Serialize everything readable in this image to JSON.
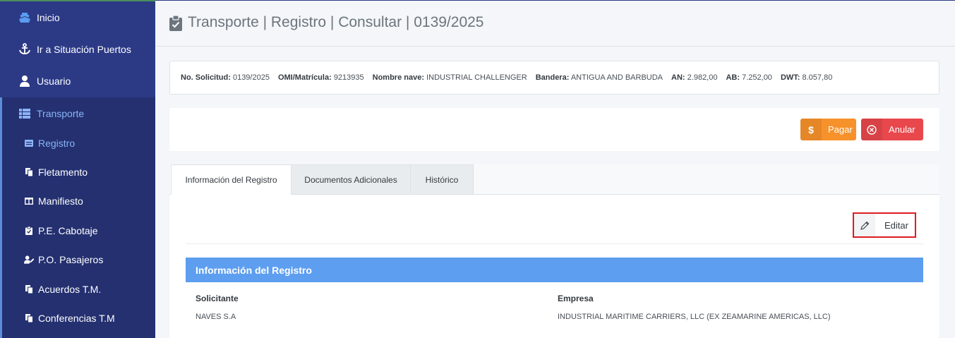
{
  "sidebar": {
    "items": [
      {
        "label": "Inicio",
        "icon": "ship-icon"
      },
      {
        "label": "Ir a Situación Puertos",
        "icon": "anchor-icon"
      },
      {
        "label": "Usuario",
        "icon": "user-icon"
      },
      {
        "label": "Transporte",
        "icon": "list-icon"
      }
    ],
    "subitems": [
      {
        "label": "Registro",
        "icon": "id-card-icon"
      },
      {
        "label": "Fletamento",
        "icon": "copy-icon"
      },
      {
        "label": "Manifiesto",
        "icon": "columns-icon"
      },
      {
        "label": "P.E. Cabotaje",
        "icon": "clipboard-check-icon"
      },
      {
        "label": "P.O. Pasajeros",
        "icon": "user-edit-icon"
      },
      {
        "label": "Acuerdos T.M.",
        "icon": "copy-icon"
      },
      {
        "label": "Conferencias T.M",
        "icon": "copy-icon"
      }
    ]
  },
  "header": {
    "title": "Transporte | Registro | Consultar | 0139/2025"
  },
  "infobar": [
    {
      "label": "No. Solicitud:",
      "value": "0139/2025"
    },
    {
      "label": "OMI/Matrícula:",
      "value": "9213935"
    },
    {
      "label": "Nombre nave:",
      "value": "INDUSTRIAL CHALLENGER"
    },
    {
      "label": "Bandera:",
      "value": "ANTIGUA AND BARBUDA"
    },
    {
      "label": "AN:",
      "value": "2.982,00"
    },
    {
      "label": "AB:",
      "value": "7.252,00"
    },
    {
      "label": "DWT:",
      "value": "8.057,80"
    }
  ],
  "actions": {
    "pay_label": "Pagar",
    "cancel_label": "Anular"
  },
  "tabs": [
    "Información del Registro",
    "Documentos Adicionales",
    "Histórico"
  ],
  "edit_label": "Editar",
  "section": {
    "title": "Información del Registro",
    "fields": [
      {
        "label": "Solicitante",
        "value": "NAVES S.A"
      },
      {
        "label": "Empresa",
        "value": "INDUSTRIAL MARITIME CARRIERS, LLC (EX ZEAMARINE AMERICAS, LLC)"
      }
    ]
  },
  "colors": {
    "sidebar": "#2c3a86",
    "accent": "#5d9ef0",
    "pay": "#f7922b",
    "cancel": "#e8474c",
    "highlight": "#dc1c22"
  }
}
